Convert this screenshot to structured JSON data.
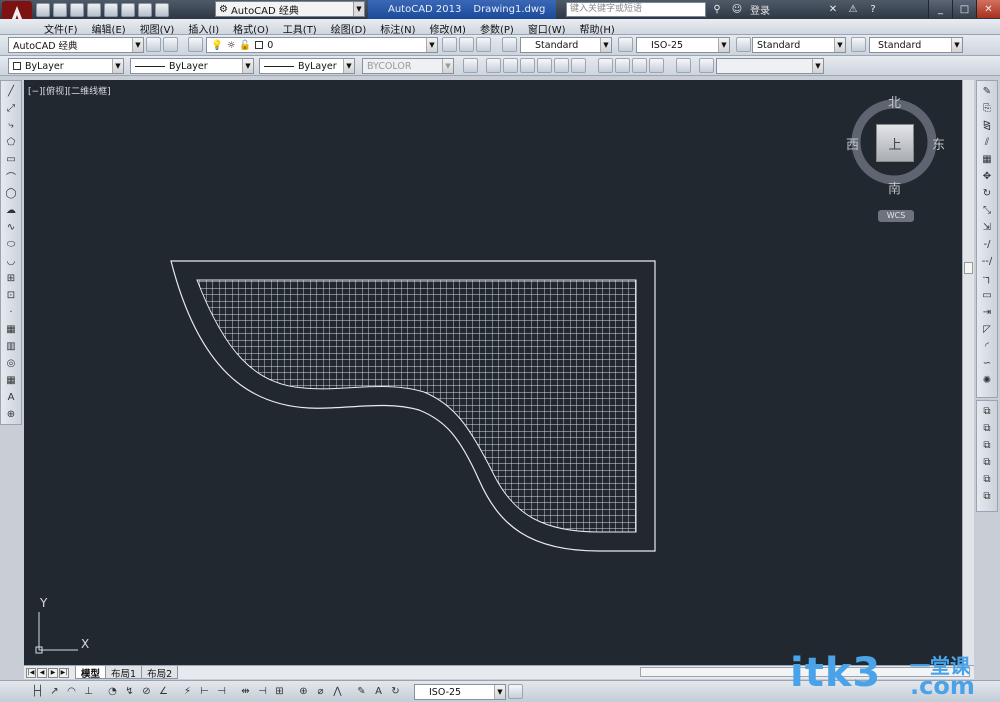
{
  "window": {
    "app_title": "AutoCAD 2013",
    "doc_title": "Drawing1.dwg",
    "workspace": "AutoCAD 经典",
    "search_placeholder": "键入关键字或短语",
    "login": "登录"
  },
  "menu": [
    "文件(F)",
    "编辑(E)",
    "视图(V)",
    "插入(I)",
    "格式(O)",
    "工具(T)",
    "绘图(D)",
    "标注(N)",
    "修改(M)",
    "参数(P)",
    "窗口(W)",
    "帮助(H)"
  ],
  "toolbar1": {
    "workspace": "AutoCAD 经典",
    "layer": "0",
    "text_style": "Standard",
    "dim_style": "ISO-25",
    "table_style": "Standard",
    "mleader_style": "Standard"
  },
  "toolbar2": {
    "color": "ByLayer",
    "linetype": "ByLayer",
    "lineweight": "ByLayer",
    "plotstyle": "BYCOLOR"
  },
  "viewport": {
    "label": "[−][俯视][二维线框]"
  },
  "viewcube": {
    "north": "北",
    "south": "南",
    "east": "东",
    "west": "西",
    "top_face": "上",
    "wcs": "WCS"
  },
  "ucs": {
    "x": "X",
    "y": "Y"
  },
  "tabs": [
    "模型",
    "布局1",
    "布局2"
  ],
  "bottom_dim_style": "ISO-25",
  "watermark": {
    "text": "itk3",
    "com": ".com",
    "cn": "一堂课"
  },
  "colors": {
    "canvas": "#212830",
    "accent": "#1b4a9a",
    "watermark": "#4aa3e8"
  }
}
